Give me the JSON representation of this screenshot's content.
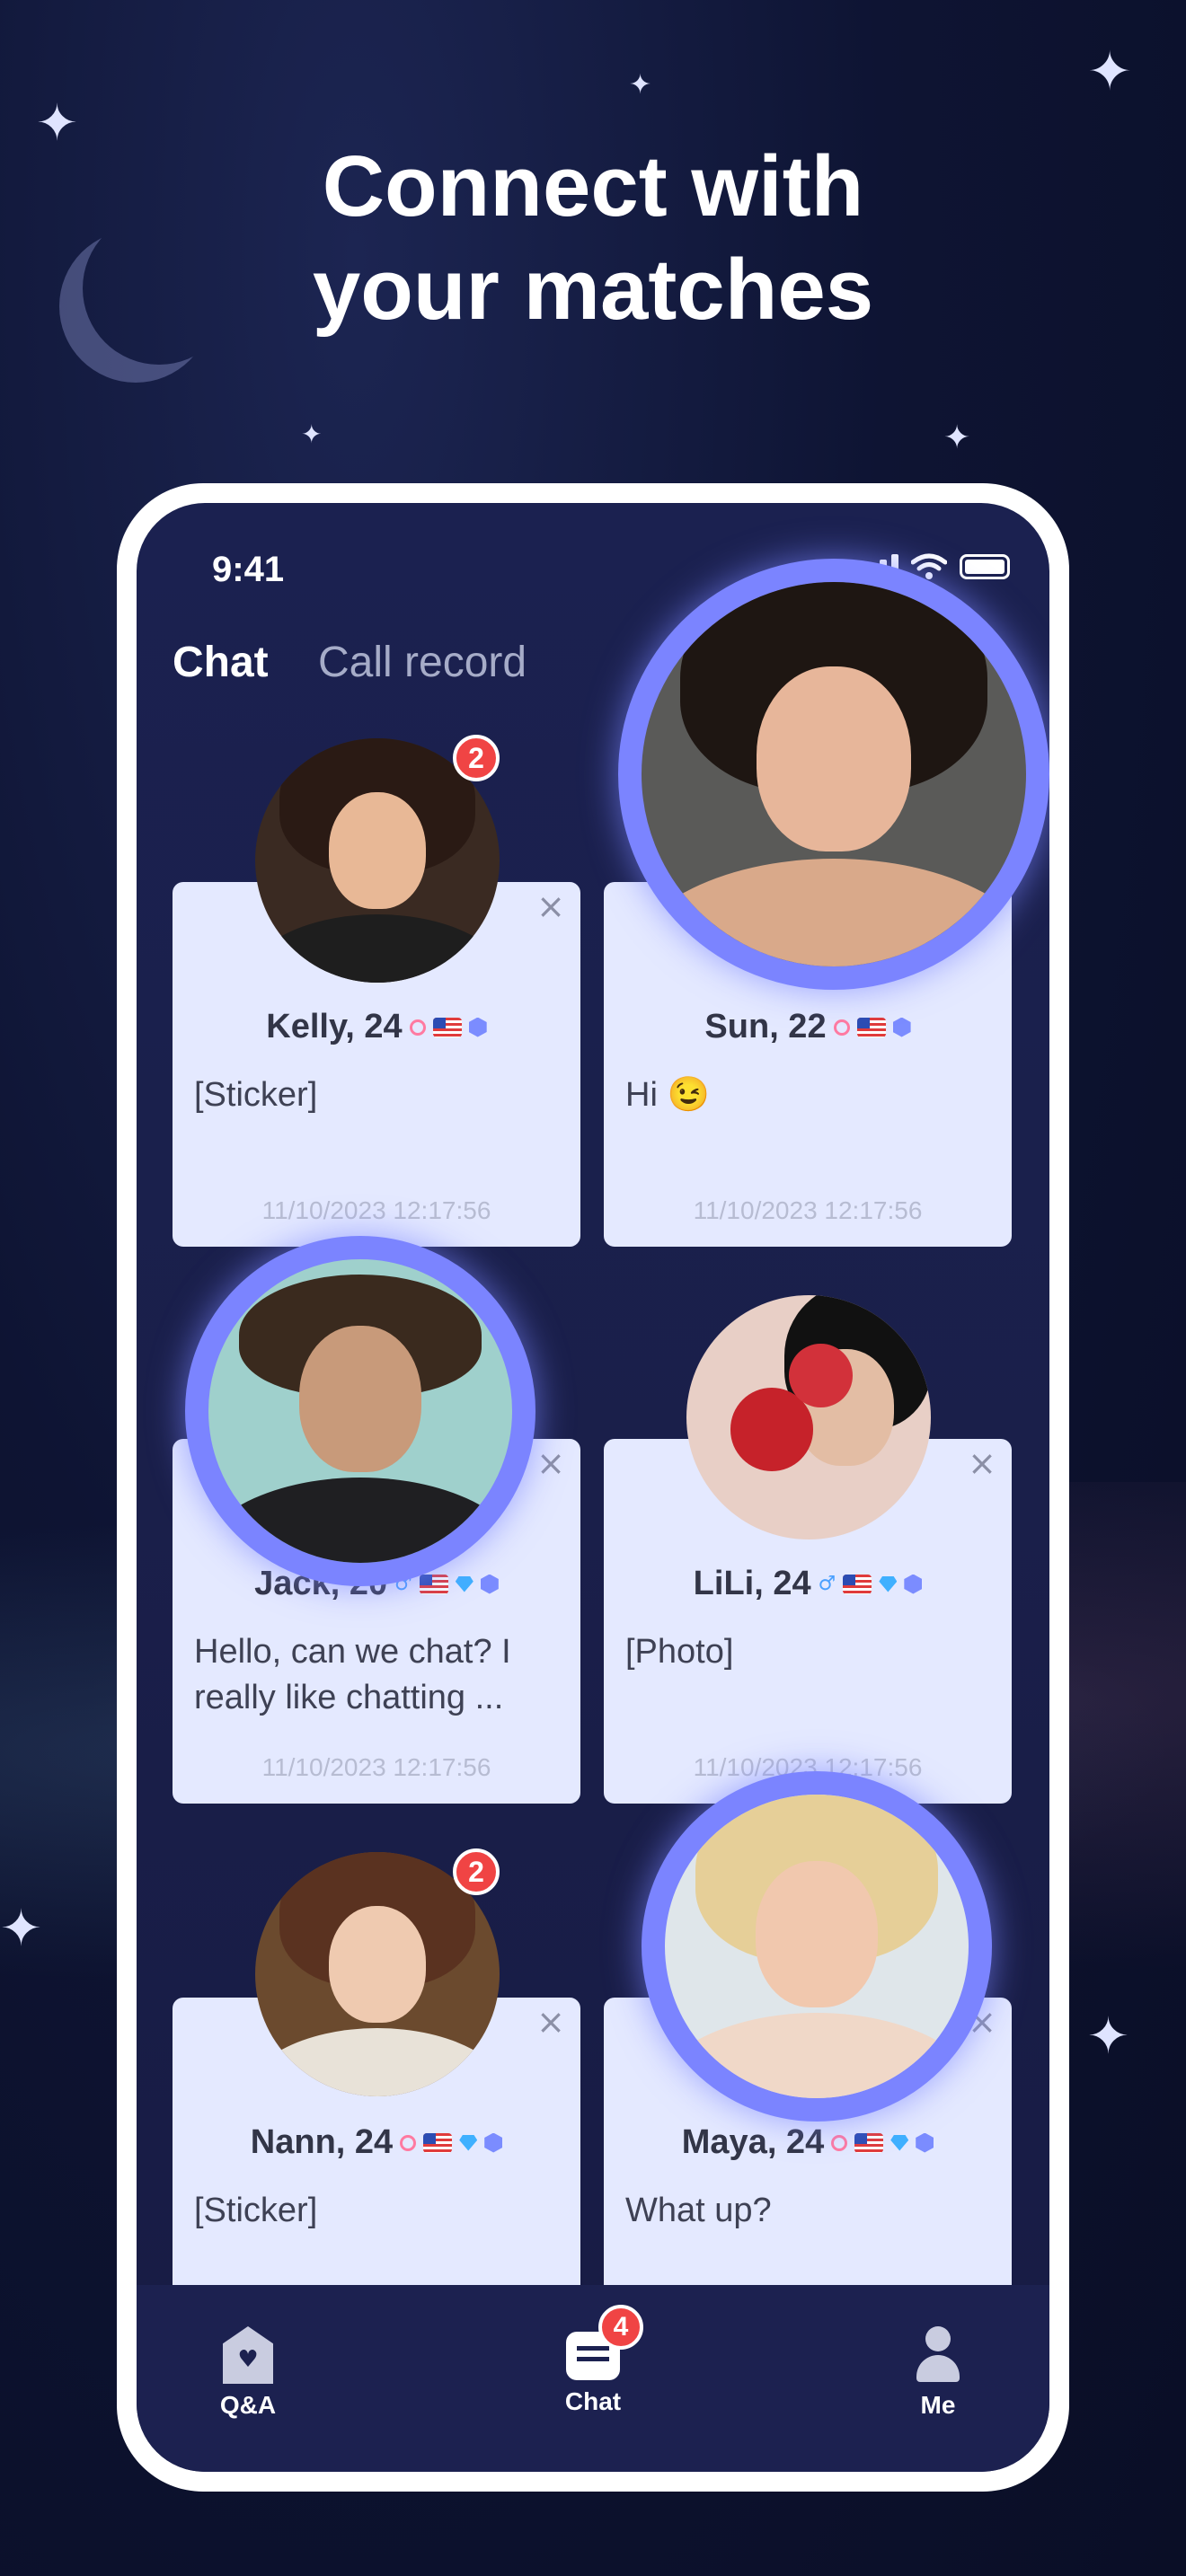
{
  "headline": {
    "line1": "Connect with",
    "line2": "your matches"
  },
  "status_bar": {
    "time": "9:41"
  },
  "tabs": {
    "chat": "Chat",
    "call_record": "Call record"
  },
  "cards": [
    {
      "name": "Kelly, 24",
      "message": "[Sticker]",
      "time": "11/10/2023 12:17:56",
      "badge": "2",
      "close_icon": "×"
    },
    {
      "name": "Sun, 22",
      "message": "Hi 😉",
      "time": "11/10/2023 12:17:56",
      "close_icon": "×"
    },
    {
      "name": "Jack, 20",
      "message": "Hello, can we chat? I really like chatting ...",
      "time": "11/10/2023 12:17:56",
      "close_icon": "×"
    },
    {
      "name": "LiLi, 24",
      "message": "[Photo]",
      "time": "11/10/2023 12:17:56",
      "close_icon": "×"
    },
    {
      "name": "Nann, 24",
      "message": "[Sticker]",
      "time": "",
      "badge": "2",
      "close_icon": "×"
    },
    {
      "name": "Maya, 24",
      "message": "What up?",
      "time": "",
      "close_icon": "×"
    }
  ],
  "tabbar": {
    "items": [
      {
        "label": "Q&A",
        "icon": "home-heart-icon"
      },
      {
        "label": "Chat",
        "icon": "chat-icon",
        "badge": "4"
      },
      {
        "label": "Me",
        "icon": "person-icon"
      }
    ]
  },
  "colors": {
    "accent_ring": "#7b84ff",
    "card_bg": "#e4e9ff",
    "badge_red": "#f04444"
  }
}
